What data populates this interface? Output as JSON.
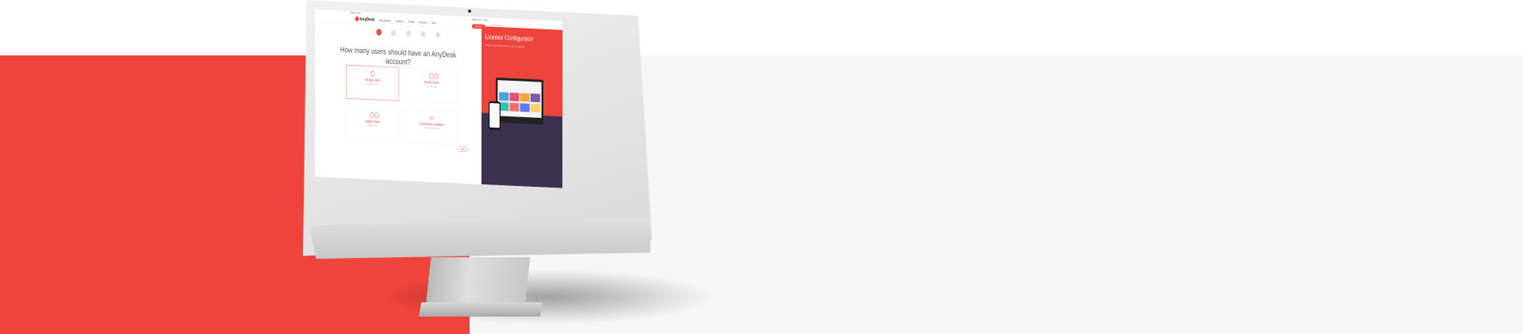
{
  "site": {
    "header_top": "Sign In / Help",
    "brand": "AnyDesk",
    "nav": [
      "Why AnyDesk",
      "Solutions",
      "Pricing",
      "Company",
      "Blog"
    ],
    "header_right": "Support +49 ...  Login",
    "download_label": "Download",
    "buy_label": "Buy Now"
  },
  "configurator": {
    "steps": [
      "1",
      "2",
      "3",
      "4",
      "5"
    ],
    "active_step": 1,
    "question": "How many users should have an AnyDesk account?",
    "options": [
      {
        "title": "Single User",
        "desc": "for individual users",
        "icon": "user-icon"
      },
      {
        "title": "Small Team",
        "desc": "for small teams",
        "icon": "users-icon"
      },
      {
        "title": "Large Team",
        "desc": "for larger teams",
        "icon": "team-icon"
      },
      {
        "title": "Enterprise network",
        "desc": "for enterprise networks",
        "icon": "monitor-icon"
      }
    ],
    "next_label": "Next"
  },
  "side_panel": {
    "title": "License Configurator",
    "subtitle": "Find your ideal AnyDesk license in a few simple steps"
  },
  "colors": {
    "accent": "#ef443b",
    "dark_panel": "#3a3350",
    "background_grey": "#f6f6f6"
  }
}
